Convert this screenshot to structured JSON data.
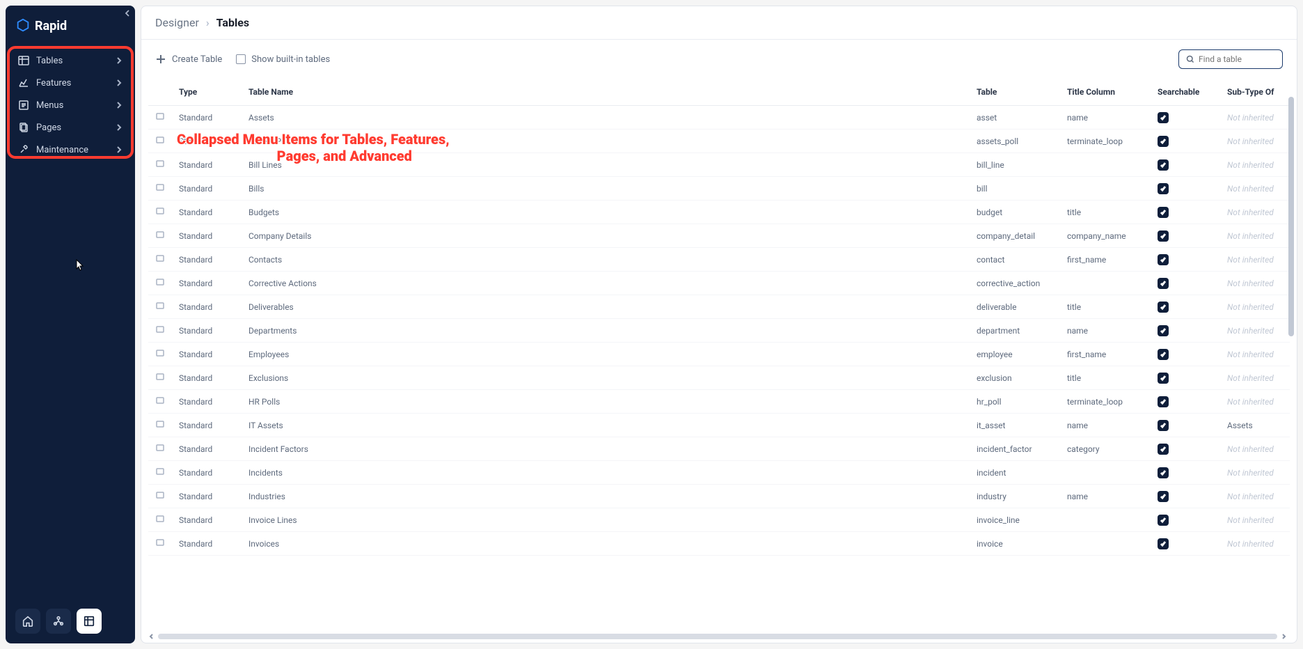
{
  "brand": "Rapid",
  "breadcrumb": {
    "parent": "Designer",
    "current": "Tables"
  },
  "sidebar": {
    "items": [
      {
        "label": "Tables"
      },
      {
        "label": "Features"
      },
      {
        "label": "Menus"
      },
      {
        "label": "Pages"
      },
      {
        "label": "Maintenance"
      }
    ]
  },
  "toolbar": {
    "create": "Create Table",
    "show_builtin": "Show built-in tables",
    "search_placeholder": "Find a table"
  },
  "columns": {
    "type": "Type",
    "name": "Table Name",
    "table": "Table",
    "title_col": "Title Column",
    "searchable": "Searchable",
    "subtype": "Sub-Type Of"
  },
  "not_inherited": "Not inherited",
  "rows": [
    {
      "type": "Standard",
      "name": "Assets",
      "table": "asset",
      "title": "name",
      "searchable": true,
      "sub": null
    },
    {
      "type": "Standard",
      "name": "Assets Polls",
      "table": "assets_poll",
      "title": "terminate_loop",
      "searchable": true,
      "sub": null
    },
    {
      "type": "Standard",
      "name": "Bill Lines",
      "table": "bill_line",
      "title": "",
      "searchable": true,
      "sub": null
    },
    {
      "type": "Standard",
      "name": "Bills",
      "table": "bill",
      "title": "",
      "searchable": true,
      "sub": null
    },
    {
      "type": "Standard",
      "name": "Budgets",
      "table": "budget",
      "title": "title",
      "searchable": true,
      "sub": null
    },
    {
      "type": "Standard",
      "name": "Company Details",
      "table": "company_detail",
      "title": "company_name",
      "searchable": true,
      "sub": null
    },
    {
      "type": "Standard",
      "name": "Contacts",
      "table": "contact",
      "title": "first_name",
      "searchable": true,
      "sub": null
    },
    {
      "type": "Standard",
      "name": "Corrective Actions",
      "table": "corrective_action",
      "title": "",
      "searchable": true,
      "sub": null
    },
    {
      "type": "Standard",
      "name": "Deliverables",
      "table": "deliverable",
      "title": "title",
      "searchable": true,
      "sub": null
    },
    {
      "type": "Standard",
      "name": "Departments",
      "table": "department",
      "title": "name",
      "searchable": true,
      "sub": null
    },
    {
      "type": "Standard",
      "name": "Employees",
      "table": "employee",
      "title": "first_name",
      "searchable": true,
      "sub": null
    },
    {
      "type": "Standard",
      "name": "Exclusions",
      "table": "exclusion",
      "title": "title",
      "searchable": true,
      "sub": null
    },
    {
      "type": "Standard",
      "name": "HR Polls",
      "table": "hr_poll",
      "title": "terminate_loop",
      "searchable": true,
      "sub": null
    },
    {
      "type": "Standard",
      "name": "IT Assets",
      "table": "it_asset",
      "title": "name",
      "searchable": true,
      "sub": "Assets"
    },
    {
      "type": "Standard",
      "name": "Incident Factors",
      "table": "incident_factor",
      "title": "category",
      "searchable": true,
      "sub": null
    },
    {
      "type": "Standard",
      "name": "Incidents",
      "table": "incident",
      "title": "",
      "searchable": true,
      "sub": null
    },
    {
      "type": "Standard",
      "name": "Industries",
      "table": "industry",
      "title": "name",
      "searchable": true,
      "sub": null
    },
    {
      "type": "Standard",
      "name": "Invoice Lines",
      "table": "invoice_line",
      "title": "",
      "searchable": true,
      "sub": null
    },
    {
      "type": "Standard",
      "name": "Invoices",
      "table": "invoice",
      "title": "",
      "searchable": true,
      "sub": null
    }
  ],
  "annotation": {
    "line1": "Collapsed Menu Items for Tables, Features,",
    "line2": "Pages, and Advanced"
  }
}
